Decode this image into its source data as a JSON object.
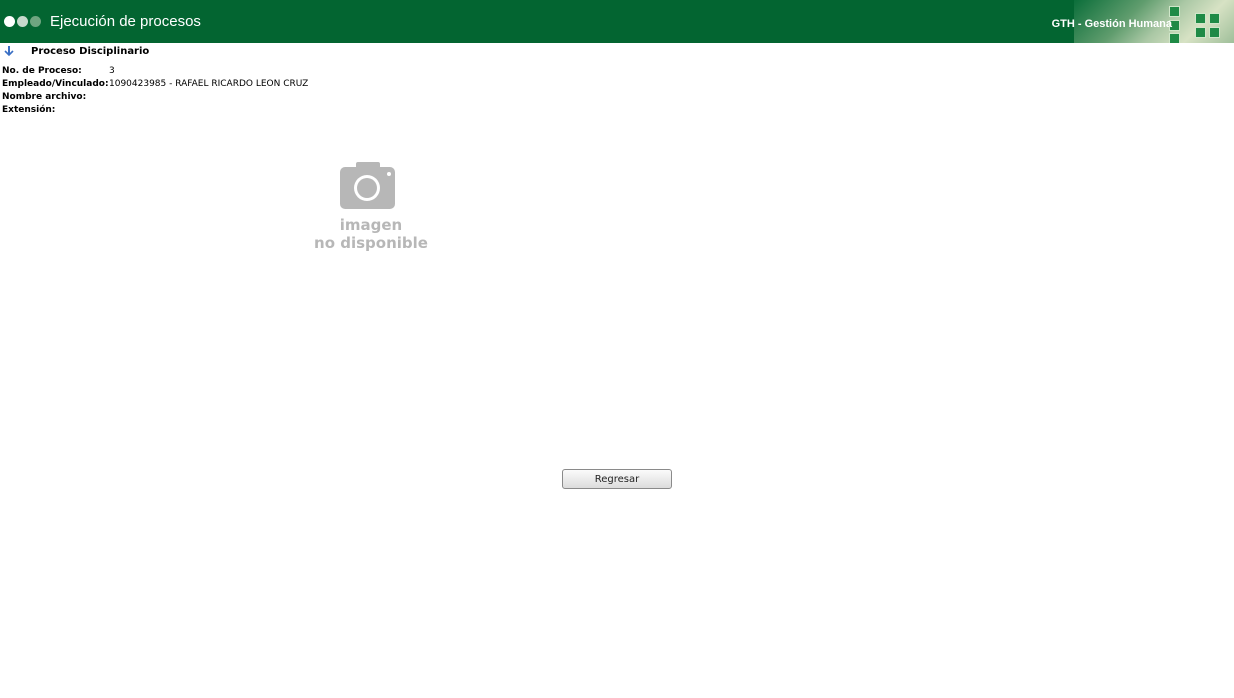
{
  "header": {
    "title": "Ejecución de procesos",
    "module": "GTH - Gestión Humana"
  },
  "section": {
    "title": "Proceso Disciplinario"
  },
  "details": {
    "process_label": "No. de Proceso:",
    "process_value": "3",
    "employee_label": "Empleado/Vinculado:",
    "employee_value": "1090423985 - RAFAEL RICARDO LEON CRUZ",
    "filename_label": "Nombre archivo:",
    "filename_value": "",
    "extension_label": "Extensión:",
    "extension_value": ""
  },
  "image_placeholder": {
    "line1": "imagen",
    "line2": "no disponible",
    "icon": "camera-icon"
  },
  "actions": {
    "back_label": "Regresar"
  },
  "colors": {
    "header_bg": "#036531",
    "placeholder_gray": "#b7b7b7"
  }
}
